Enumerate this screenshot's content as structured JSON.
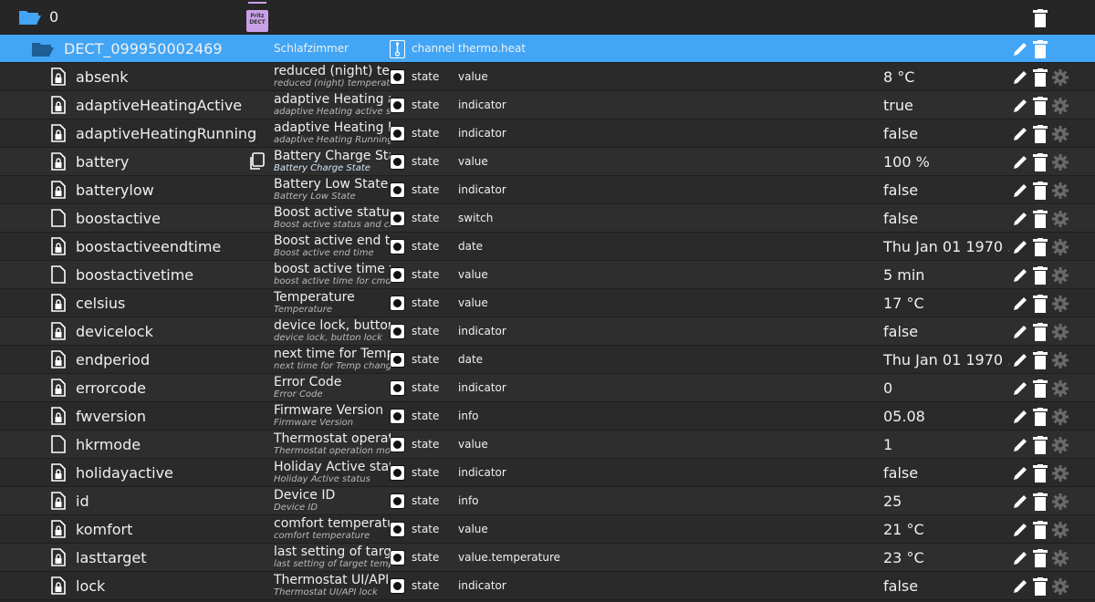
{
  "top": {
    "label": "0",
    "badge_line1": "Fritz",
    "badge_line2": "DECT"
  },
  "channel": {
    "id": "DECT_099950002469",
    "name": "Schlafzimmer",
    "type": "channel",
    "role": "thermo.heat"
  },
  "colors": {
    "accent": "#42a5f5",
    "selected": "#2b7bbd",
    "background": "#262626"
  },
  "rows": [
    {
      "id": "absenk",
      "title": "reduced (night) temp",
      "subtitle": "reduced (night) temperature",
      "type": "state",
      "role": "value",
      "value": "8 °C",
      "file_icon": "locked-file-icon"
    },
    {
      "id": "adaptiveHeatingActive",
      "title": "adaptive Heating act",
      "subtitle": "adaptive Heating active statu",
      "type": "state",
      "role": "indicator",
      "value": "true",
      "file_icon": "locked-file-icon"
    },
    {
      "id": "adaptiveHeatingRunning",
      "title": "adaptive Heating Rur",
      "subtitle": "adaptive Heating Running sta",
      "type": "state",
      "role": "indicator",
      "value": "false",
      "file_icon": "locked-file-icon"
    },
    {
      "id": "battery",
      "title": "Battery Charge State",
      "subtitle": "Battery Charge State",
      "type": "state",
      "role": "value",
      "value": "100 %",
      "file_icon": "locked-file-icon",
      "selected": true
    },
    {
      "id": "batterylow",
      "title": "Battery Low State",
      "subtitle": "Battery Low State",
      "type": "state",
      "role": "indicator",
      "value": "false",
      "file_icon": "locked-file-icon"
    },
    {
      "id": "boostactive",
      "title": "Boost active status a",
      "subtitle": "Boost active status and cmd",
      "type": "state",
      "role": "switch",
      "value": "false",
      "file_icon": "file-icon"
    },
    {
      "id": "boostactiveendtime",
      "title": "Boost active end time",
      "subtitle": "Boost active end time",
      "type": "state",
      "role": "date",
      "value": "Thu Jan 01 1970 ...",
      "file_icon": "locked-file-icon"
    },
    {
      "id": "boostactivetime",
      "title": "boost active time for",
      "subtitle": "boost active time for cmd",
      "type": "state",
      "role": "value",
      "value": "5 min",
      "file_icon": "file-icon"
    },
    {
      "id": "celsius",
      "title": "Temperature",
      "subtitle": "Temperature",
      "type": "state",
      "role": "value",
      "value": "17 °C",
      "file_icon": "locked-file-icon"
    },
    {
      "id": "devicelock",
      "title": "device lock, button lo",
      "subtitle": "device lock, button lock",
      "type": "state",
      "role": "indicator",
      "value": "false",
      "file_icon": "locked-file-icon"
    },
    {
      "id": "endperiod",
      "title": "next time for Temp c",
      "subtitle": "next time for Temp change",
      "type": "state",
      "role": "date",
      "value": "Thu Jan 01 1970 ...",
      "file_icon": "locked-file-icon"
    },
    {
      "id": "errorcode",
      "title": "Error Code",
      "subtitle": "Error Code",
      "type": "state",
      "role": "indicator",
      "value": "0",
      "file_icon": "locked-file-icon"
    },
    {
      "id": "fwversion",
      "title": "Firmware Version",
      "subtitle": "Firmware Version",
      "type": "state",
      "role": "info",
      "value": "05.08",
      "file_icon": "locked-file-icon"
    },
    {
      "id": "hkrmode",
      "title": "Thermostat operation",
      "subtitle": "Thermostat operation mode",
      "type": "state",
      "role": "value",
      "value": "1",
      "file_icon": "file-icon"
    },
    {
      "id": "holidayactive",
      "title": "Holiday Active status",
      "subtitle": "Holiday Active status",
      "type": "state",
      "role": "indicator",
      "value": "false",
      "file_icon": "locked-file-icon"
    },
    {
      "id": "id",
      "title": "Device ID",
      "subtitle": "Device ID",
      "type": "state",
      "role": "info",
      "value": "25",
      "file_icon": "locked-file-icon"
    },
    {
      "id": "komfort",
      "title": "comfort temperature",
      "subtitle": "comfort temperature",
      "type": "state",
      "role": "value",
      "value": "21 °C",
      "file_icon": "locked-file-icon"
    },
    {
      "id": "lasttarget",
      "title": "last setting of target",
      "subtitle": "last setting of target temp",
      "type": "state",
      "role": "value.temperature",
      "value": "23 °C",
      "file_icon": "locked-file-icon"
    },
    {
      "id": "lock",
      "title": "Thermostat UI/API lo",
      "subtitle": "Thermostat UI/API lock",
      "type": "state",
      "role": "indicator",
      "value": "false",
      "file_icon": "locked-file-icon"
    }
  ]
}
